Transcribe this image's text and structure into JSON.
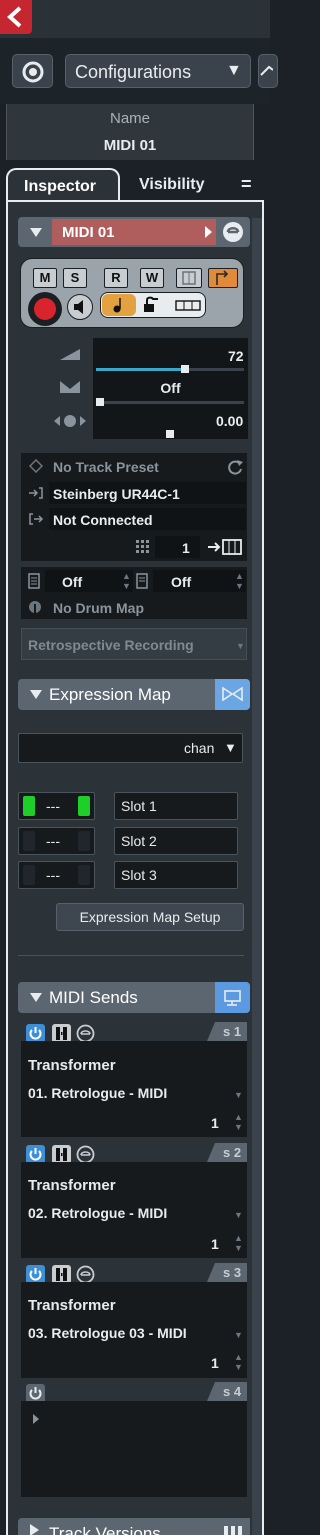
{
  "toolbar": {
    "configurations_label": "Configurations",
    "dropdown_arrow": "▼"
  },
  "track_name": {
    "label": "Name",
    "value": "MIDI 01"
  },
  "tabs": [
    {
      "label": "Inspector",
      "active": true
    },
    {
      "label": "Visibility",
      "active": false
    }
  ],
  "tab_menu": "=",
  "track_header": {
    "name": "MIDI 01",
    "color": "#b05d5d"
  },
  "track_buttons": {
    "mute": "M",
    "solo": "S",
    "read": "R",
    "write": "W"
  },
  "faders": {
    "volume": "72",
    "volume_fill": 0.6,
    "pan": "Off",
    "pan_fill": 0.0,
    "delay": "0.00",
    "delay_fill": 0.5
  },
  "routing": {
    "track_preset": "No Track Preset",
    "input": "Steinberg UR44C-1",
    "output": "Not Connected",
    "channel": "1"
  },
  "drum": {
    "program": "Off",
    "bank": "Off",
    "drum_map": "No Drum Map"
  },
  "retrospective": "Retrospective Recording",
  "expression_map": {
    "title": "Expression Map",
    "selector": "chan",
    "slots": [
      {
        "key": "---",
        "name": "Slot 1",
        "active": true
      },
      {
        "key": "---",
        "name": "Slot 2",
        "active": false
      },
      {
        "key": "---",
        "name": "Slot 3",
        "active": false
      }
    ],
    "setup_button": "Expression Map Setup"
  },
  "midi_sends": {
    "title": "MIDI Sends",
    "sends": [
      {
        "slot": "s 1",
        "plugin": "Transformer",
        "destination": "01. Retrologue - MIDI",
        "channel": "1"
      },
      {
        "slot": "s 2",
        "plugin": "Transformer",
        "destination": "02. Retrologue - MIDI",
        "channel": "1"
      },
      {
        "slot": "s 3",
        "plugin": "Transformer",
        "destination": "03. Retrologue 03 - MIDI",
        "channel": "1"
      },
      {
        "slot": "s 4"
      }
    ]
  },
  "track_versions": {
    "title": "Track Versions"
  },
  "colors": {
    "accent_blue": "#3d8fd6",
    "active_green": "#1ecf2a",
    "record_red": "#d8242c",
    "track_color": "#b05d5d",
    "orange": "#e08a3a",
    "fader_cyan": "#3aa6c8"
  },
  "icons": {
    "app_logo": "cubase-logo-icon",
    "config": "configuration-icon"
  }
}
